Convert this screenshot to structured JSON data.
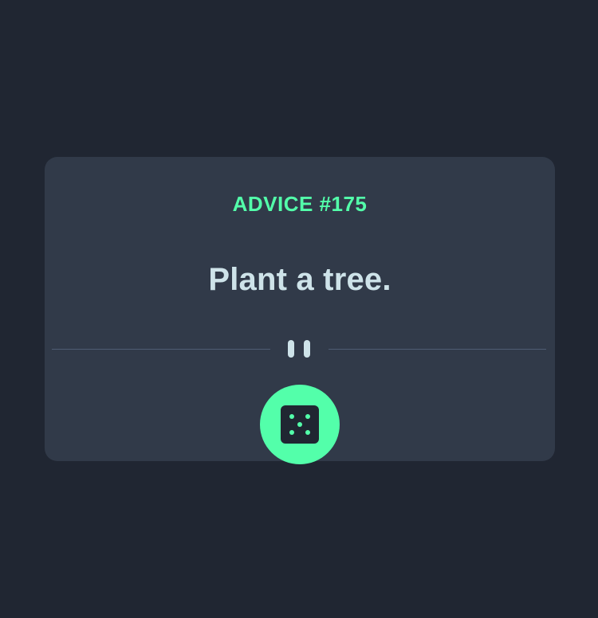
{
  "advice": {
    "id_label": "ADVICE #175",
    "text": "Plant a tree."
  },
  "colors": {
    "background": "#202632",
    "card": "#313a49",
    "accent": "#53ffaa",
    "text": "#cee3e9",
    "divider": "#4f5d74"
  },
  "icons": {
    "divider_ornament": "pause-icon",
    "button": "dice-icon"
  }
}
